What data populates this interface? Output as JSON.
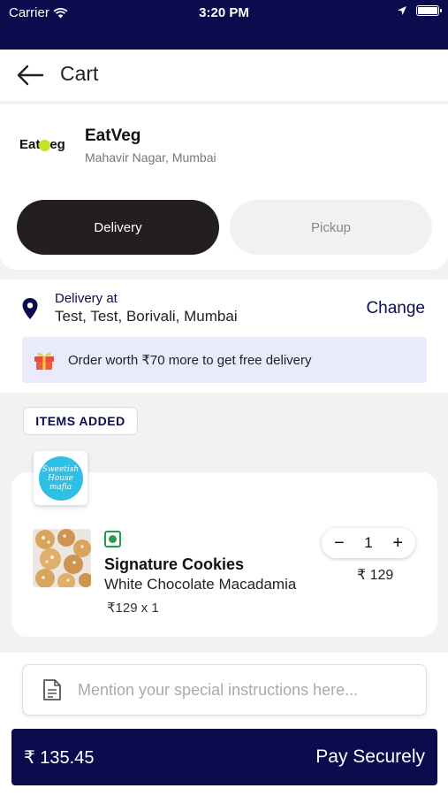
{
  "status_bar": {
    "carrier": "Carrier",
    "time": "3:20 PM"
  },
  "header": {
    "title": "Cart"
  },
  "restaurant": {
    "logo_text_left": "Eat",
    "logo_text_right": "eg",
    "name": "EatVeg",
    "location": "Mahavir Nagar, Mumbai"
  },
  "modes": {
    "delivery": "Delivery",
    "pickup": "Pickup",
    "selected": "Delivery"
  },
  "address": {
    "label": "Delivery at",
    "value": "Test, Test, Borivali, Mumbai",
    "change": "Change"
  },
  "offer": {
    "text": "Order worth ₹70 more to get free delivery"
  },
  "items_section": {
    "label": "ITEMS ADDED",
    "brand_logo_text": "Sweetish House mafia",
    "items": [
      {
        "name": "Signature Cookies",
        "variant": "White Chocolate Macadamia",
        "unit_line": "₹129 x 1",
        "quantity": "1",
        "price": "₹ 129",
        "veg": true
      }
    ]
  },
  "instructions": {
    "placeholder": "Mention your special instructions here..."
  },
  "pay": {
    "total": "₹ 135.45",
    "label": "Pay Securely"
  },
  "colors": {
    "navy": "#0b0c4e",
    "veg_green": "#1aa34a",
    "offer_bg": "#e9eafc"
  }
}
